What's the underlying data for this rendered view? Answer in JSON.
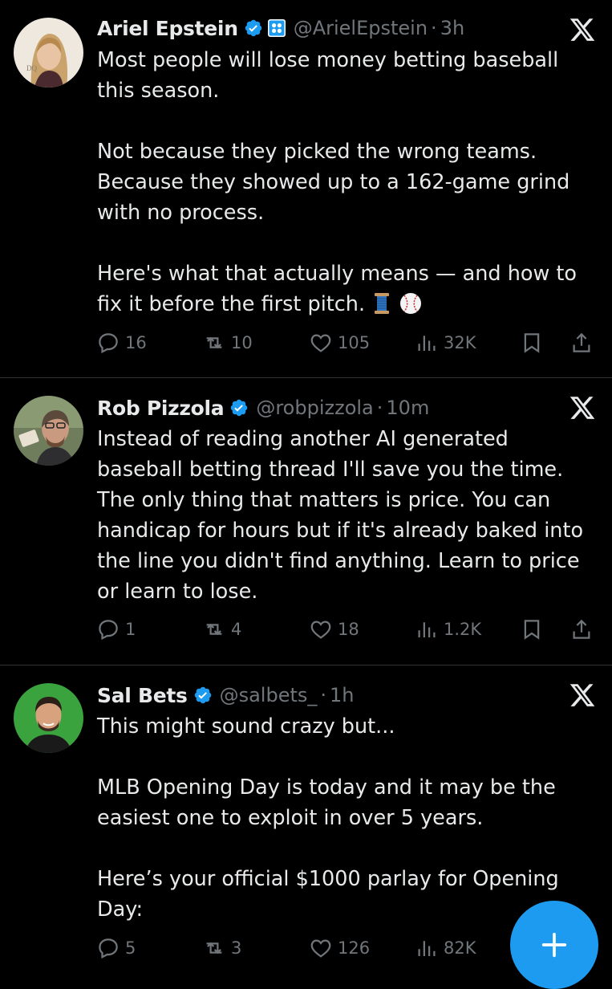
{
  "tweets": [
    {
      "name": "Ariel Epstein",
      "handle": "@ArielEpstein",
      "time": "3h",
      "paragraphs": [
        "Most people will lose money betting baseball\nthis season.",
        "Not because they picked the wrong teams.\nBecause they showed up to a 162-game grind\nwith no process.",
        "Here's what that actually means — and how to\nfix it before the first pitch."
      ],
      "emojis": [
        "thread-spool",
        "baseball"
      ],
      "replies": "16",
      "reposts": "10",
      "likes": "105",
      "views": "32K"
    },
    {
      "name": "Rob Pizzola",
      "handle": "@robpizzola",
      "time": "10m",
      "paragraphs": [
        "Instead of reading another AI generated\nbaseball betting thread I'll save you the time.\nThe only thing that matters is price. You can\nhandicap for hours but if it's already baked into\nthe line you didn't find anything. Learn to price\nor learn to lose."
      ],
      "replies": "1",
      "reposts": "4",
      "likes": "18",
      "views": "1.2K"
    },
    {
      "name": "Sal Bets",
      "handle": "@salbets_",
      "time": "1h",
      "paragraphs": [
        "This might sound crazy but...",
        "MLB Opening Day is today and it may be the\neasiest one to exploit in over 5 years.",
        "Here’s your official $1000 parlay for Opening\nDay:"
      ],
      "replies": "5",
      "reposts": "3",
      "likes": "126",
      "views": "82K"
    }
  ],
  "colors": {
    "background": "#000000",
    "text": "#e7e9ea",
    "muted": "#71767b",
    "verified": "#1d9bf0",
    "fab": "#1d9bf0"
  },
  "icons": [
    "verified-badge-icon",
    "affiliate-badge-icon",
    "x-logo-icon",
    "reply-icon",
    "repost-icon",
    "like-icon",
    "views-icon",
    "bookmark-icon",
    "share-icon",
    "plus-icon"
  ]
}
